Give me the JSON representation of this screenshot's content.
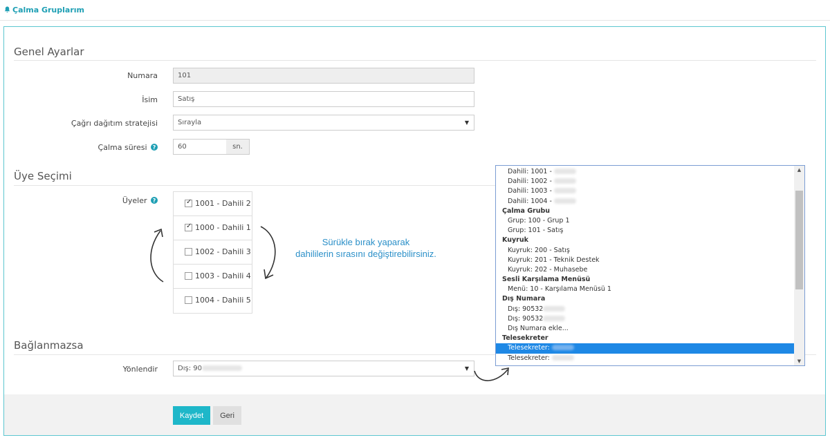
{
  "page": {
    "title": "Çalma Gruplarım"
  },
  "sections": {
    "general": "Genel Ayarlar",
    "members": "Üye Seçimi",
    "fallback": "Bağlanmazsa"
  },
  "fields": {
    "number": {
      "label": "Numara",
      "value": "101"
    },
    "name": {
      "label": "İsim",
      "value": "Satış"
    },
    "strategy": {
      "label": "Çağrı dağıtım stratejisi",
      "value": "Sırayla"
    },
    "ring_time": {
      "label": "Çalma süresi",
      "value": "60",
      "unit": "sn."
    },
    "members_label": "Üyeler",
    "redirect": {
      "label": "Yönlendir",
      "value": "Dış: 90"
    }
  },
  "members": [
    {
      "label": "1001 - Dahili 2",
      "checked": true
    },
    {
      "label": "1000 - Dahili 1",
      "checked": true
    },
    {
      "label": "1002 - Dahili 3",
      "checked": false
    },
    {
      "label": "1003 - Dahili 4",
      "checked": false
    },
    {
      "label": "1004 - Dahili 5",
      "checked": false
    }
  ],
  "hint": {
    "line1": "Sürükle bırak yaparak",
    "line2": "dahililerin sırasını değiştirebilirsiniz."
  },
  "dropdown": {
    "rows": [
      {
        "type": "item",
        "text": "Dahili: 1001 - ",
        "blur": true
      },
      {
        "type": "item",
        "text": "Dahili: 1002 - ",
        "blur": true
      },
      {
        "type": "item",
        "text": "Dahili: 1003 - ",
        "blur": true
      },
      {
        "type": "item",
        "text": "Dahili: 1004 - ",
        "blur": true
      },
      {
        "type": "group",
        "text": "Çalma Grubu"
      },
      {
        "type": "item",
        "text": "Grup: 100 - Grup 1"
      },
      {
        "type": "item",
        "text": "Grup: 101 - Satış"
      },
      {
        "type": "group",
        "text": "Kuyruk"
      },
      {
        "type": "item",
        "text": "Kuyruk: 200 - Satış"
      },
      {
        "type": "item",
        "text": "Kuyruk: 201 - Teknik Destek"
      },
      {
        "type": "item",
        "text": "Kuyruk: 202 - Muhasebe"
      },
      {
        "type": "group",
        "text": "Sesli Karşılama Menüsü"
      },
      {
        "type": "item",
        "text": "Menü: 10 - Karşılama Menüsü 1"
      },
      {
        "type": "group",
        "text": "Dış Numara"
      },
      {
        "type": "item",
        "text": "Dış: 90532",
        "blur": true
      },
      {
        "type": "item",
        "text": "Dış: 90532",
        "blur": true
      },
      {
        "type": "item",
        "text": "Dış Numara ekle..."
      },
      {
        "type": "group",
        "text": "Telesekreter"
      },
      {
        "type": "item",
        "text": "Telesekreter: ",
        "blur": true,
        "selected": true
      },
      {
        "type": "item",
        "text": "Telesekreter: ",
        "blur": true
      }
    ]
  },
  "buttons": {
    "save": "Kaydet",
    "back": "Geri"
  },
  "colors": {
    "accent": "#1eb7c9",
    "selection": "#1e88e5",
    "hint": "#2a8fc8"
  }
}
